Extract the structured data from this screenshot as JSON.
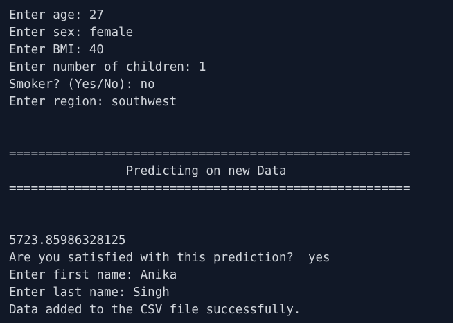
{
  "terminal": {
    "lines": [
      "Enter age: 27",
      "Enter sex: female",
      "Enter BMI: 40",
      "Enter number of children: 1",
      "Smoker? (Yes/No): no",
      "Enter region: southwest",
      "=======================================================",
      "                Predicting on new Data",
      "=======================================================",
      "5723.85986328125",
      "Are you satisfied with this prediction?  yes",
      "Enter first name: Anika",
      "Enter last name: Singh",
      "Data added to the CSV file successfully.",
      "   ...  ..."
    ]
  }
}
